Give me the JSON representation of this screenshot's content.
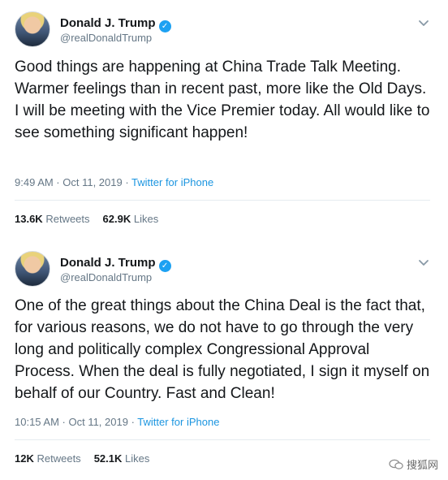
{
  "tweets": [
    {
      "name": "Donald J. Trump",
      "handle": "@realDonaldTrump",
      "text": "Good things are happening at China Trade Talk Meeting. Warmer feelings than in recent past, more like the Old Days. I will be meeting with the Vice Premier today. All would like to see something significant happen!",
      "time": "9:49 AM · Oct 11, 2019 · ",
      "source": "Twitter for iPhone",
      "retweets_count": "13.6K",
      "retweets_label": "Retweets",
      "likes_count": "62.9K",
      "likes_label": "Likes"
    },
    {
      "name": "Donald J. Trump",
      "handle": "@realDonaldTrump",
      "text": "One of the great things about the China Deal is the fact that, for various reasons, we do not have to go through the very long and politically complex Congressional Approval Process. When the deal is fully negotiated, I sign it myself on behalf of our Country. Fast and Clean!",
      "time": "10:15 AM · Oct 11, 2019 · ",
      "source": "Twitter for iPhone",
      "retweets_count": "12K",
      "retweets_label": "Retweets",
      "likes_count": "52.1K",
      "likes_label": "Likes"
    }
  ],
  "watermark": {
    "text": "搜狐网"
  },
  "colors": {
    "verified": "#1da1f2",
    "link": "#1b95e0",
    "muted": "#657786"
  },
  "icons": {
    "verified": "verified-badge-icon",
    "menu": "chevron-down-icon",
    "watermark": "wechat-icon"
  }
}
